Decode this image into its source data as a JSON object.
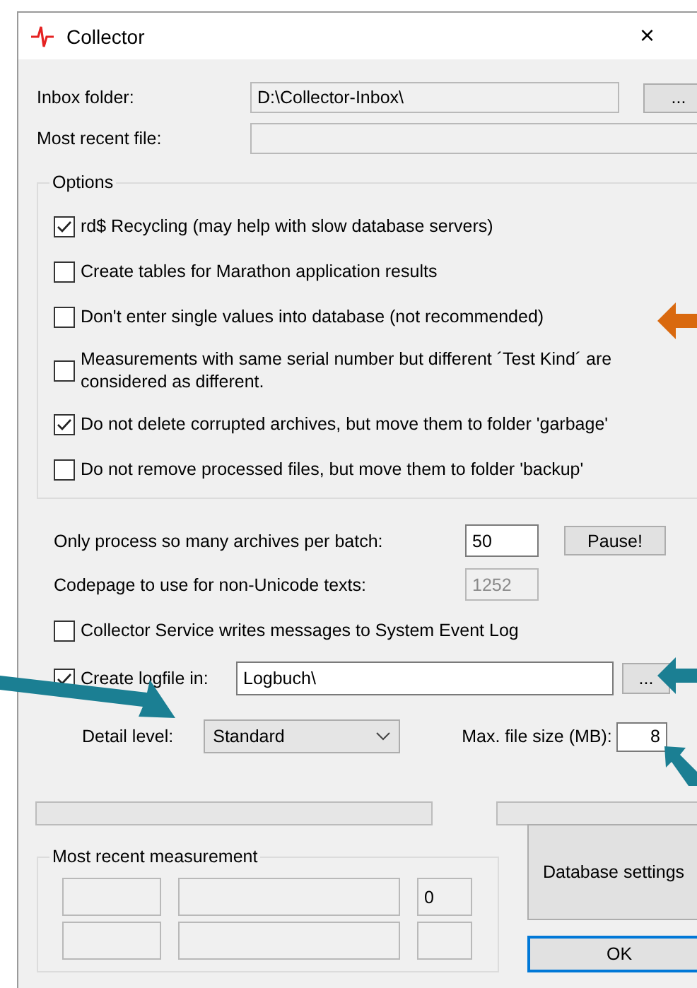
{
  "window": {
    "title": "Collector",
    "close": "×"
  },
  "inbox_folder": {
    "label": "Inbox folder:",
    "value": "D:\\Collector-Inbox\\",
    "browse": "..."
  },
  "most_recent_file": {
    "label": "Most recent file:"
  },
  "options": {
    "title": "Options",
    "items": [
      {
        "label": "rd$ Recycling (may help with slow database servers)",
        "checked": true
      },
      {
        "label": "Create tables for Marathon application results",
        "checked": false
      },
      {
        "label": "Don't enter single values into database (not recommended)",
        "checked": false
      },
      {
        "label": "Measurements with same serial number but different ´Test Kind´ are considered as different.",
        "checked": false
      },
      {
        "label": "Do not delete corrupted archives, but move them to folder 'garbage'",
        "checked": true
      },
      {
        "label": "Do not remove processed files, but move them to folder 'backup'",
        "checked": false
      }
    ]
  },
  "batch": {
    "label": "Only process so many archives per batch:",
    "value": "50",
    "button": "Pause!"
  },
  "codepage": {
    "label": "Codepage to use for non-Unicode texts:",
    "value": "1252",
    "disabled": true
  },
  "event_log": {
    "label": "Collector Service writes messages to System Event Log",
    "checked": false
  },
  "logfile": {
    "label": "Create logfile in:",
    "checked": true,
    "value": "Logbuch\\",
    "browse": "..."
  },
  "detail_level": {
    "label": "Detail level:",
    "value": "Standard"
  },
  "max_file_size": {
    "label": "Max. file size (MB):",
    "value": "8"
  },
  "progress": [
    {
      "level": 0
    },
    {
      "level": 0
    }
  ],
  "measurement": {
    "title": "Most recent measurement",
    "count": "0"
  },
  "buttons": {
    "database_settings": "Database settings",
    "ok": "OK"
  },
  "annotations": [
    {
      "kind": "left",
      "color": "#d9690f"
    },
    {
      "kind": "down-right",
      "color": "#1b7f93"
    },
    {
      "kind": "left",
      "color": "#1b7f93"
    },
    {
      "kind": "up-left",
      "color": "#1b7f93"
    }
  ]
}
